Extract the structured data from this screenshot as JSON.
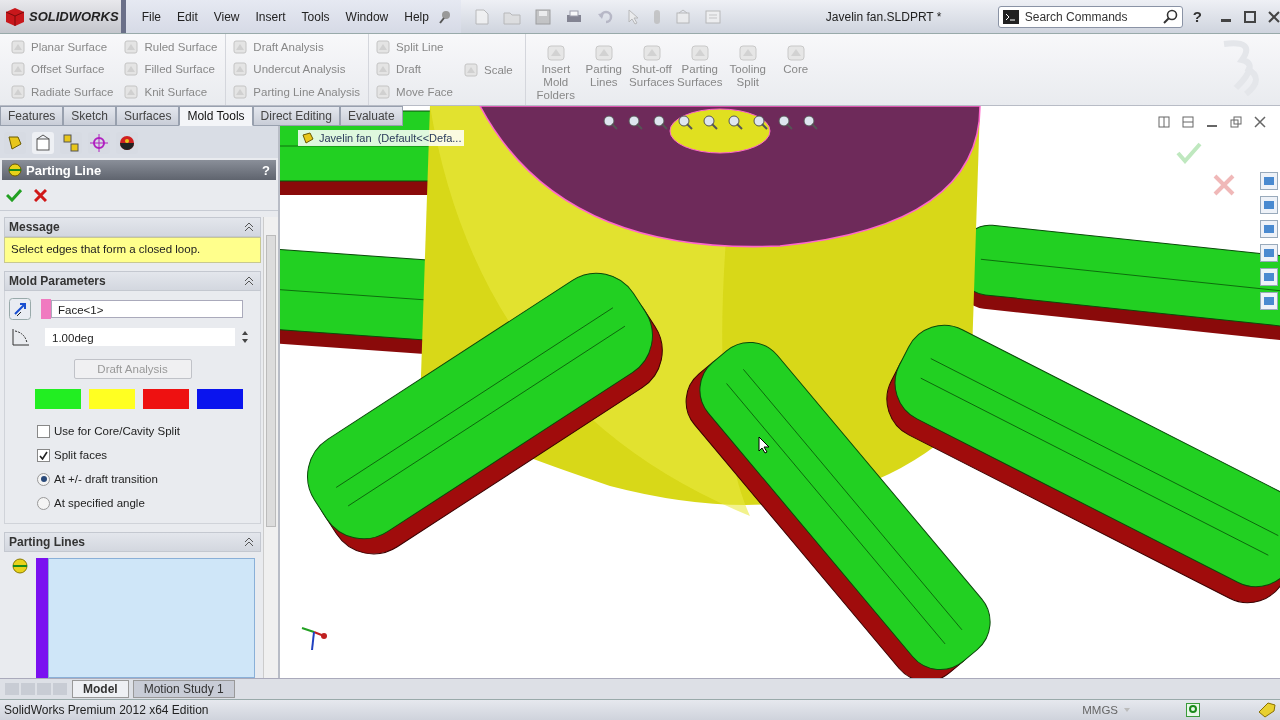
{
  "app": {
    "logo": "SOLIDWORKS",
    "title": "Javelin fan.SLDPRT *",
    "help": "?"
  },
  "menu": [
    "File",
    "Edit",
    "View",
    "Insert",
    "Tools",
    "Window",
    "Help"
  ],
  "search": {
    "placeholder": "Search Commands"
  },
  "ribbon": {
    "columns": [
      [
        "Planar Surface",
        "Offset Surface",
        "Radiate Surface"
      ],
      [
        "Ruled Surface",
        "Filled Surface",
        "Knit Surface"
      ],
      [
        "Draft Analysis",
        "Undercut Analysis",
        "Parting Line Analysis"
      ],
      [
        "Split Line",
        "Draft",
        "Move Face"
      ],
      [
        "Scale"
      ]
    ],
    "large_buttons": [
      "Insert Mold Folders",
      "Parting Lines",
      "Shut-off Surfaces",
      "Parting Surfaces",
      "Tooling Split",
      "Core"
    ]
  },
  "command_tabs": [
    {
      "label": "Features",
      "selected": false
    },
    {
      "label": "Sketch",
      "selected": false
    },
    {
      "label": "Surfaces",
      "selected": false
    },
    {
      "label": "Mold Tools",
      "selected": true
    },
    {
      "label": "Direct Editing",
      "selected": false
    },
    {
      "label": "Evaluate",
      "selected": false
    }
  ],
  "property_manager": {
    "title": "Parting Line",
    "help": "?",
    "message": {
      "heading": "Message",
      "text": "Select edges that form a closed loop."
    },
    "mold_parameters": {
      "heading": "Mold Parameters",
      "face": "Face<1>",
      "angle": "1.00deg",
      "analysis_button": "Draft Analysis",
      "swatches": [
        {
          "color": "#22ee22"
        },
        {
          "color": "#ffff22"
        },
        {
          "color": "#ee1111"
        },
        {
          "color": "#0a14ee"
        }
      ],
      "options": [
        {
          "kind": "checkbox",
          "label": "Use for Core/Cavity Split",
          "checked": false
        },
        {
          "kind": "checkbox",
          "label": "Split faces",
          "checked": true
        },
        {
          "kind": "radio",
          "label": "At +/- draft transition",
          "selected": true
        },
        {
          "kind": "radio",
          "label": "At specified angle",
          "selected": false
        }
      ]
    },
    "parting_lines": {
      "heading": "Parting Lines"
    }
  },
  "viewport": {
    "tree_label": "Javelin fan  (Default<<Defa..."
  },
  "bottom_tabs": [
    {
      "label": "Model",
      "selected": true
    },
    {
      "label": "Motion Study 1",
      "selected": false
    }
  ],
  "status_bar": {
    "text": "SolidWorks Premium 2012 x64 Edition",
    "units": "MMGS"
  }
}
